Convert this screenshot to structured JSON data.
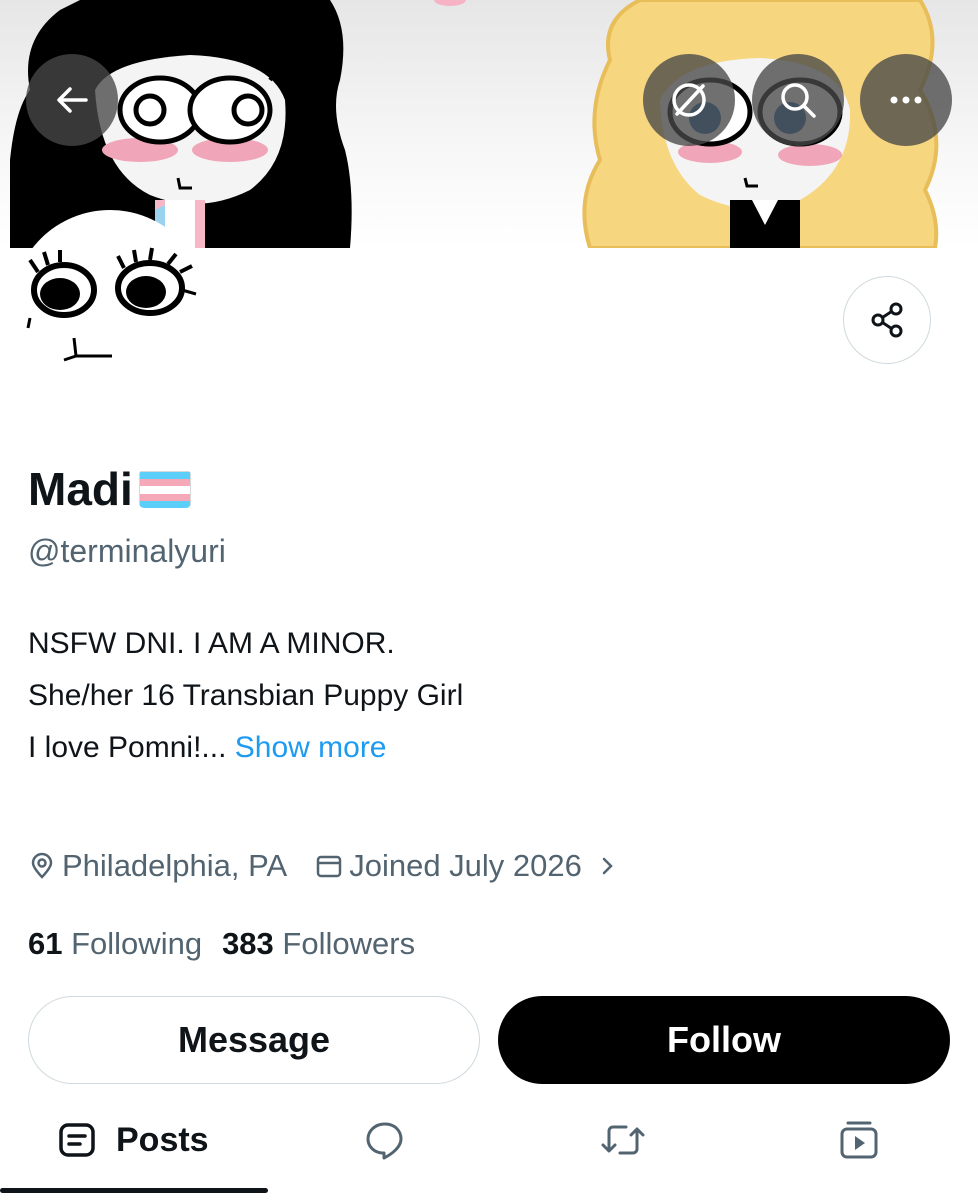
{
  "profile": {
    "display_name": "Madi",
    "flag_emoji": "transgender-flag",
    "handle": "@terminalyuri",
    "bio_lines": [
      "NSFW DNI. I AM A MINOR.",
      "She/her 16 Transbian Puppy Girl",
      "I love Pomni!..."
    ],
    "show_more": "Show more",
    "location": "Philadelphia, PA",
    "joined": "Joined July 2026",
    "following_count": "61",
    "following_label": "Following",
    "followers_count": "383",
    "followers_label": "Followers"
  },
  "actions": {
    "message_label": "Message",
    "follow_label": "Follow"
  },
  "header_icons": [
    "back-arrow-icon",
    "grok-icon",
    "search-icon",
    "more-options-icon"
  ],
  "tabs": [
    {
      "label": "Posts",
      "icon": "posts-icon",
      "active": true
    },
    {
      "label": "",
      "icon": "replies-icon",
      "active": false
    },
    {
      "label": "",
      "icon": "repost-icon",
      "active": false
    },
    {
      "label": "",
      "icon": "media-icon",
      "active": false
    }
  ],
  "colors": {
    "accent": "#1d9bf0",
    "text_primary": "#0f1419",
    "text_secondary": "#536471",
    "follow_bg": "#000000"
  }
}
